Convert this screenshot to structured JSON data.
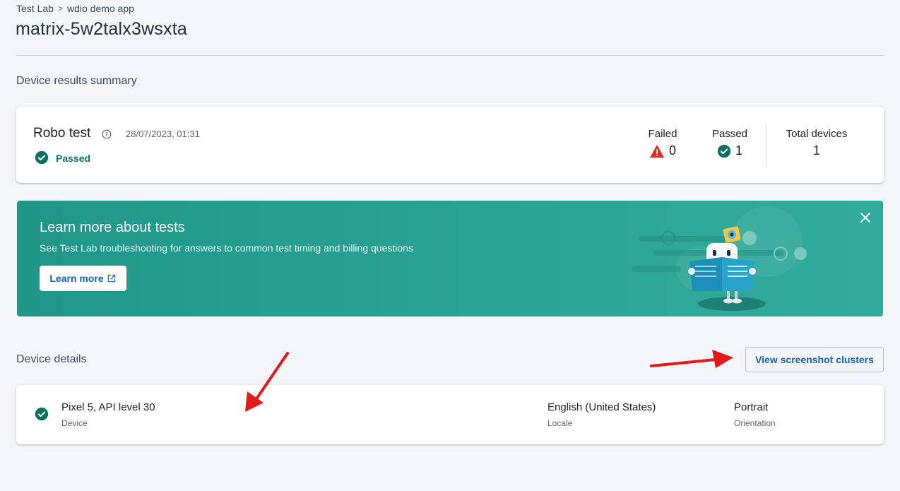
{
  "breadcrumb": {
    "items": [
      "Test Lab",
      "wdio demo app"
    ],
    "separator": ">"
  },
  "page_title": "matrix-5w2talx3wsxta",
  "summary_section": {
    "title": "Device results summary"
  },
  "summary": {
    "test_name": "Robo test",
    "timestamp": "28/07/2023, 01:31",
    "status": "Passed",
    "failed_label": "Failed",
    "failed_count": "0",
    "passed_label": "Passed",
    "passed_count": "1",
    "total_label": "Total devices",
    "total_count": "1"
  },
  "banner": {
    "title": "Learn more about tests",
    "text": "See Test Lab troubleshooting for answers to common test timing and billing questions",
    "button_label": "Learn more",
    "bg_color": "#2ba596"
  },
  "details_section": {
    "title": "Device details",
    "button_label": "View screenshot clusters"
  },
  "device": {
    "name": "Pixel 5, API level 30",
    "name_caption": "Device",
    "locale": "English (United States)",
    "locale_caption": "Locale",
    "orientation": "Portrait",
    "orientation_caption": "Orientation"
  },
  "colors": {
    "success": "#0d7060",
    "error": "#d93025",
    "link": "#1a5fb4",
    "annotation_arrow": "#e11b1b"
  },
  "icons": [
    "info-icon",
    "check-circle-icon",
    "warning-icon",
    "close-icon",
    "open-in-new-icon"
  ]
}
